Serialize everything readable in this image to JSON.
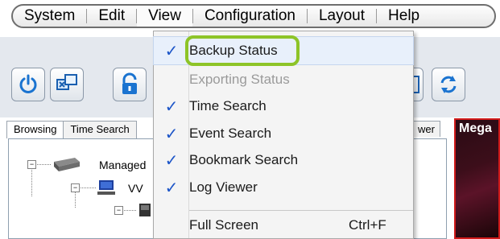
{
  "menubar": {
    "items": [
      {
        "label": "System"
      },
      {
        "label": "Edit"
      },
      {
        "label": "View"
      },
      {
        "label": "Configuration"
      },
      {
        "label": "Layout"
      },
      {
        "label": "Help"
      }
    ]
  },
  "dropdown": {
    "items": [
      {
        "label": "Backup Status",
        "checked": true
      },
      {
        "label": "Exporting Status",
        "checked": false
      },
      {
        "label": "Time Search",
        "checked": true
      },
      {
        "label": "Event Search",
        "checked": true
      },
      {
        "label": "Bookmark Search",
        "checked": true
      },
      {
        "label": "Log Viewer",
        "checked": true
      },
      {
        "label": "Full Screen",
        "checked": false,
        "shortcut": "Ctrl+F"
      }
    ],
    "check_glyph": "✓",
    "highlight_color": "#8dc428"
  },
  "tabs": {
    "browsing": "Browsing",
    "time_search": "Time Search",
    "right_partial": "wer"
  },
  "tree": {
    "managed_label": "Managed",
    "vw_label": "VV"
  },
  "video": {
    "label": "Mega"
  },
  "toolbar": {
    "icons": [
      "power-icon",
      "network-icon",
      "lock-icon",
      "window-icon",
      "refresh-icon"
    ]
  }
}
